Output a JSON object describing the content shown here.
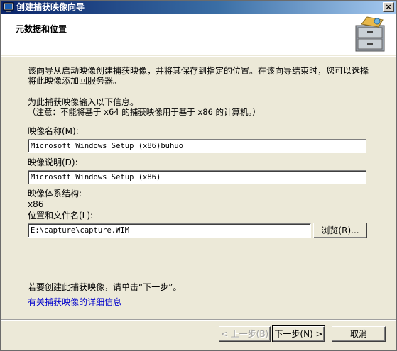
{
  "window": {
    "title": "创建捕获映像向导",
    "close_label": "×"
  },
  "header": {
    "page_title": "元数据和位置"
  },
  "intro": {
    "text": "该向导从启动映像创建捕获映像，并将其保存到指定的位置。在该向导结束时，您可以选择将此映像添加回服务器。"
  },
  "prompt": {
    "text": "为此捕获映像输入以下信息。",
    "note": "（注意：不能将基于 x64 的捕获映像用于基于 x86 的计算机。）"
  },
  "fields": {
    "image_name_label": "映像名称(M):",
    "image_name_value": "Microsoft Windows Setup (x86)buhuo",
    "image_desc_label": "映像说明(D):",
    "image_desc_value": "Microsoft Windows Setup (x86)",
    "arch_label": "映像体系结构:",
    "arch_value": "x86",
    "location_label": "位置和文件名(L):",
    "location_value": "E:\\capture\\capture.WIM",
    "browse_label": "浏览(R)..."
  },
  "footer": {
    "instruction": "若要创建此捕获映像，请单击“下一步”。",
    "help_link": "有关捕获映像的详细信息",
    "back_label": "< 上一步(B)",
    "next_label": "下一步(N) >",
    "cancel_label": "取消"
  },
  "colors": {
    "titlebar_start": "#0a246a",
    "dialog_bg": "#ece9d8",
    "link": "#0000cc"
  },
  "icons": {
    "app": "computer-monitor-icon",
    "wizard": "file-cabinet-icon"
  }
}
